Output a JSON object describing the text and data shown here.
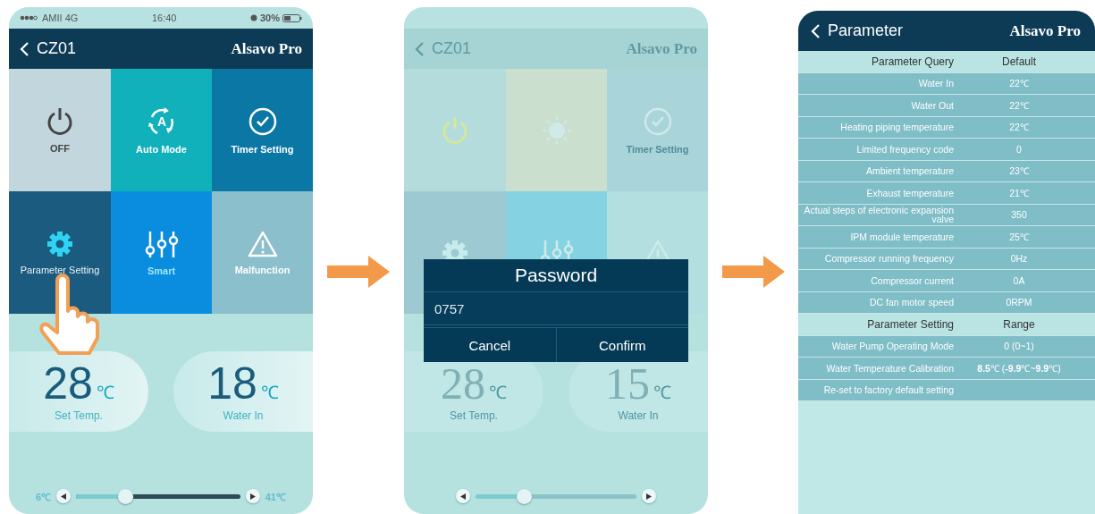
{
  "screens": [
    {
      "kind": "home",
      "dimmed": false,
      "status_bar": {
        "carrier": "AMII 4G",
        "time": "16:40",
        "battery": "30%"
      },
      "header": {
        "title": "CZ01",
        "brand": "Alsavo Pro"
      },
      "tiles": [
        {
          "kind": "power",
          "label": "OFF",
          "color": "#c1d7dd"
        },
        {
          "kind": "auto",
          "label": "Auto Mode",
          "icon_text": "A",
          "color": "#10b1ba"
        },
        {
          "kind": "timer",
          "label": "Timer Setting",
          "color": "#0a77a5"
        },
        {
          "kind": "settings",
          "label": "Parameter Setting",
          "color": "#1b5b7f",
          "pressed": true
        },
        {
          "kind": "smart",
          "label": "Smart",
          "color": "#0b8ddf"
        },
        {
          "kind": "alert",
          "label": "Malfunction",
          "color": "#8abfcb"
        }
      ],
      "readouts": [
        {
          "value": "28",
          "unit": "℃",
          "label": "Set Temp."
        },
        {
          "value": "18",
          "unit": "℃",
          "label": "Water In"
        }
      ],
      "slider": {
        "min_label": "6℃",
        "max_label": "41℃",
        "level": 0.3
      }
    },
    {
      "kind": "home",
      "dimmed": true,
      "header": {
        "title": "CZ01",
        "brand": "Alsavo Pro"
      },
      "tiles": [
        {
          "kind": "power",
          "color": "#b4dcdd"
        },
        {
          "kind": "sun",
          "color": "#cbdfcf"
        },
        {
          "kind": "timer",
          "label": "Timer Setting",
          "color": "#a8d4da"
        },
        {
          "kind": "settings",
          "color": "#9dcad2"
        },
        {
          "kind": "smart",
          "color": "#85d3e2"
        },
        {
          "kind": "alert",
          "color": "#b3dfe0"
        }
      ],
      "readouts": [
        {
          "value": "28",
          "unit": "℃",
          "label": "Set Temp."
        },
        {
          "value": "15",
          "unit": "℃",
          "label": "Water In"
        }
      ],
      "slider": {
        "level": 0.3
      },
      "dialog": {
        "title": "Password",
        "value": "0757",
        "buttons": [
          "Cancel",
          "Confirm"
        ]
      }
    },
    {
      "kind": "parameters",
      "header": {
        "title": "Parameter",
        "brand": "Alsavo Pro"
      },
      "sections": [
        {
          "heading": "Parameter Query",
          "column": "Default",
          "rows": [
            {
              "name": "Water In",
              "value": "22℃"
            },
            {
              "name": "Water Out",
              "value": "22℃"
            },
            {
              "name": "Heating piping temperature",
              "value": "22℃"
            },
            {
              "name": "Limited frequency code",
              "value": "0"
            },
            {
              "name": "Ambient temperature",
              "value": "23℃"
            },
            {
              "name": "Exhaust temperature",
              "value": "21℃"
            },
            {
              "name": "Actual steps of electronic expansion valve",
              "value": "350"
            },
            {
              "name": "IPM module temperature",
              "value": "25℃"
            },
            {
              "name": "Compressor running frequency",
              "value": "0Hz"
            },
            {
              "name": "Compressor current",
              "value": "0A"
            },
            {
              "name": "DC fan motor speed",
              "value": "0RPM"
            }
          ]
        },
        {
          "heading": "Parameter Setting",
          "column": "Range",
          "rows": [
            {
              "name": "Water Pump Operating Mode",
              "value": "0 (0~1)"
            },
            {
              "name": "Water Temperature Calibration",
              "value": "**8.5**℃ (**-9.9**℃~**9.9**℃)"
            },
            {
              "name": "Re-set to factory default setting"
            }
          ]
        }
      ]
    }
  ]
}
